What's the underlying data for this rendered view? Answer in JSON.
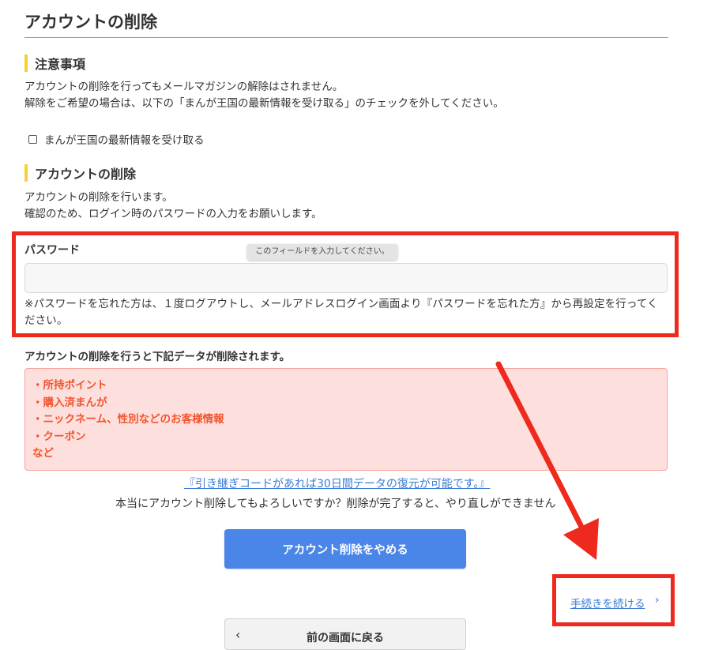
{
  "page": {
    "title": "アカウントの削除"
  },
  "notice": {
    "heading": "注意事項",
    "lines": [
      "アカウントの削除を行ってもメールマガジンの解除はされません。",
      "解除をご希望の場合は、以下の「まんが王国の最新情報を受け取る」のチェックを外してください。"
    ],
    "checkbox_label": "まんが王国の最新情報を受け取る",
    "checkbox_checked": false
  },
  "deletion": {
    "heading": "アカウントの削除",
    "lines": [
      "アカウントの削除を行います。",
      "確認のため、ログイン時のパスワードの入力をお願いします。"
    ]
  },
  "password": {
    "label": "パスワード",
    "value": "",
    "tooltip": "このフィールドを入力してください。",
    "note": "※パスワードを忘れた方は、１度ログアウトし、メールアドレスログイン画面より『パスワードを忘れた方』から再設定を行ってください。"
  },
  "warning": {
    "heading": "アカウントの削除を行うと下記データが削除されます。",
    "items": [
      "・所持ポイント",
      "・購入済まんが",
      "・ニックネーム、性別などのお客様情報",
      "・クーポン",
      "など"
    ]
  },
  "actions": {
    "transfer_code_link": "『引き継ぎコードがあれば30日間データの復元が可能です。』",
    "confirm_text": "本当にアカウント削除してもよろしいですか？削除が完了すると、やり直しができません",
    "cancel_button": "アカウント削除をやめる",
    "continue_link": "手続きを続ける",
    "continue_chevron": "›",
    "back_button": "前の画面に戻る",
    "back_arrow": "‹"
  },
  "colors": {
    "accent_yellow": "#f3d13a",
    "annotation_red": "#ee2a1e",
    "warning_text": "#f3542d",
    "warning_bg": "#fde0dd",
    "primary_blue": "#4a86e8",
    "link_blue": "#3a7bd5"
  },
  "icons": {
    "continue_icon": "chevron-right-icon",
    "back_icon": "chevron-left-icon",
    "annotation_arrow": "red-arrow-icon"
  }
}
